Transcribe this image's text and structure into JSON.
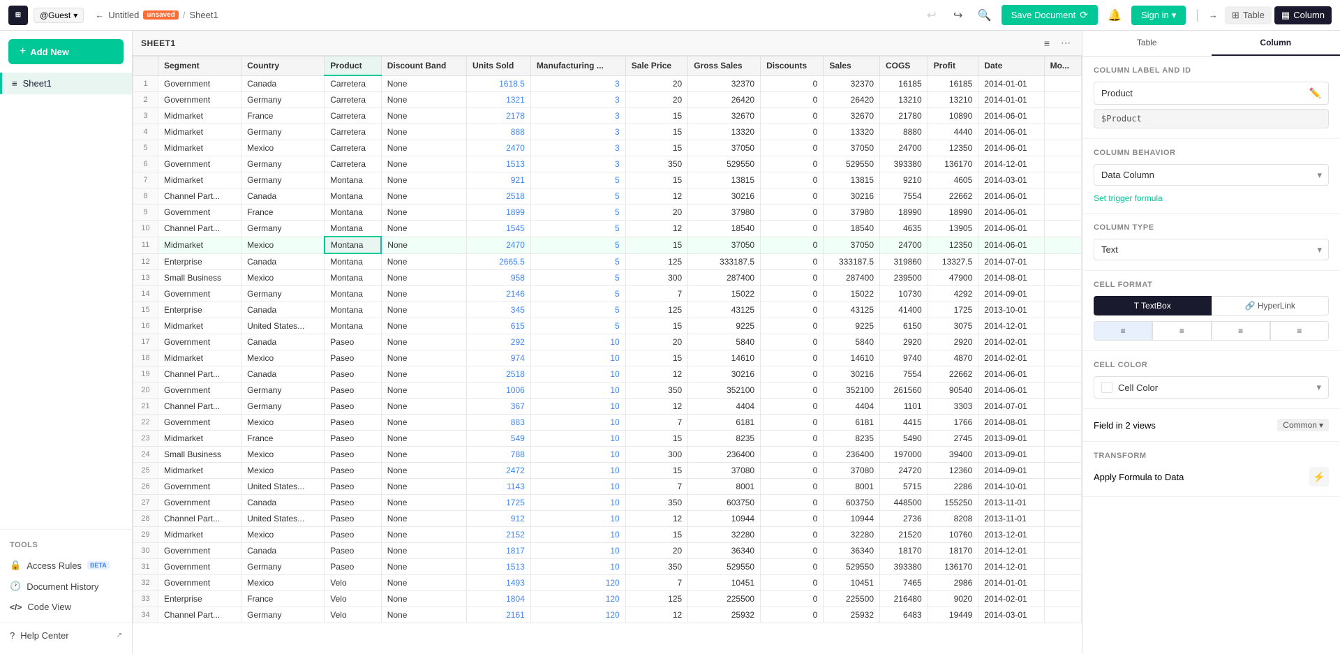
{
  "topbar": {
    "logo_text": "⊞",
    "user": "@Guest",
    "breadcrumb": {
      "doc": "Untitled",
      "unsaved": "unsaved",
      "sheet": "Sheet1"
    },
    "undo_label": "↩",
    "redo_label": "↪",
    "search_icon": "🔍",
    "save_doc_label": "Save Document",
    "bell_icon": "🔔",
    "sign_in_label": "Sign in",
    "arrow_icon": "→",
    "view_table": "Table",
    "view_column": "Column"
  },
  "sidebar": {
    "add_new": "Add New",
    "sheet_name": "Sheet1",
    "tools_label": "TOOLS",
    "tools": [
      {
        "label": "Access Rules",
        "badge": "BETA",
        "icon": "🔒",
        "ext": false
      },
      {
        "label": "Document History",
        "badge": "",
        "icon": "🕐",
        "ext": false
      },
      {
        "label": "Code View",
        "badge": "",
        "icon": "</>",
        "ext": false
      }
    ],
    "help": "Help Center",
    "help_icon": "?"
  },
  "sheet_tab": {
    "label": "SHEET1",
    "filter_icon": "≡",
    "more_icon": "⋯"
  },
  "table": {
    "columns": [
      "",
      "Segment",
      "Country",
      "Product",
      "Discount Band",
      "Units Sold",
      "Manufacturing ...",
      "Sale Price",
      "Gross Sales",
      "Discounts",
      "Sales",
      "COGS",
      "Profit",
      "Date",
      "Mo..."
    ],
    "highlighted_col": 3,
    "rows": [
      [
        1,
        "Government",
        "Canada",
        "Carretera",
        "None",
        "1618.5",
        "3",
        "20",
        "32370",
        "0",
        "32370",
        "16185",
        "16185",
        "2014-01-01",
        ""
      ],
      [
        2,
        "Government",
        "Germany",
        "Carretera",
        "None",
        "1321",
        "3",
        "20",
        "26420",
        "0",
        "26420",
        "13210",
        "13210",
        "2014-01-01",
        ""
      ],
      [
        3,
        "Midmarket",
        "France",
        "Carretera",
        "None",
        "2178",
        "3",
        "15",
        "32670",
        "0",
        "32670",
        "21780",
        "10890",
        "2014-06-01",
        ""
      ],
      [
        4,
        "Midmarket",
        "Germany",
        "Carretera",
        "None",
        "888",
        "3",
        "15",
        "13320",
        "0",
        "13320",
        "8880",
        "4440",
        "2014-06-01",
        ""
      ],
      [
        5,
        "Midmarket",
        "Mexico",
        "Carretera",
        "None",
        "2470",
        "3",
        "15",
        "37050",
        "0",
        "37050",
        "24700",
        "12350",
        "2014-06-01",
        ""
      ],
      [
        6,
        "Government",
        "Germany",
        "Carretera",
        "None",
        "1513",
        "3",
        "350",
        "529550",
        "0",
        "529550",
        "393380",
        "136170",
        "2014-12-01",
        ""
      ],
      [
        7,
        "Midmarket",
        "Germany",
        "Montana",
        "None",
        "921",
        "5",
        "15",
        "13815",
        "0",
        "13815",
        "9210",
        "4605",
        "2014-03-01",
        ""
      ],
      [
        8,
        "Channel Part...",
        "Canada",
        "Montana",
        "None",
        "2518",
        "5",
        "12",
        "30216",
        "0",
        "30216",
        "7554",
        "22662",
        "2014-06-01",
        ""
      ],
      [
        9,
        "Government",
        "France",
        "Montana",
        "None",
        "1899",
        "5",
        "20",
        "37980",
        "0",
        "37980",
        "18990",
        "18990",
        "2014-06-01",
        ""
      ],
      [
        10,
        "Channel Part...",
        "Germany",
        "Montana",
        "None",
        "1545",
        "5",
        "12",
        "18540",
        "0",
        "18540",
        "4635",
        "13905",
        "2014-06-01",
        ""
      ],
      [
        11,
        "Midmarket",
        "Mexico",
        "Montana",
        "None",
        "2470",
        "5",
        "15",
        "37050",
        "0",
        "37050",
        "24700",
        "12350",
        "2014-06-01",
        ""
      ],
      [
        12,
        "Enterprise",
        "Canada",
        "Montana",
        "None",
        "2665.5",
        "5",
        "125",
        "333187.5",
        "0",
        "333187.5",
        "319860",
        "13327.5",
        "2014-07-01",
        ""
      ],
      [
        13,
        "Small Business",
        "Mexico",
        "Montana",
        "None",
        "958",
        "5",
        "300",
        "287400",
        "0",
        "287400",
        "239500",
        "47900",
        "2014-08-01",
        ""
      ],
      [
        14,
        "Government",
        "Germany",
        "Montana",
        "None",
        "2146",
        "5",
        "7",
        "15022",
        "0",
        "15022",
        "10730",
        "4292",
        "2014-09-01",
        ""
      ],
      [
        15,
        "Enterprise",
        "Canada",
        "Montana",
        "None",
        "345",
        "5",
        "125",
        "43125",
        "0",
        "43125",
        "41400",
        "1725",
        "2013-10-01",
        ""
      ],
      [
        16,
        "Midmarket",
        "United States...",
        "Montana",
        "None",
        "615",
        "5",
        "15",
        "9225",
        "0",
        "9225",
        "6150",
        "3075",
        "2014-12-01",
        ""
      ],
      [
        17,
        "Government",
        "Canada",
        "Paseo",
        "None",
        "292",
        "10",
        "20",
        "5840",
        "0",
        "5840",
        "2920",
        "2920",
        "2014-02-01",
        ""
      ],
      [
        18,
        "Midmarket",
        "Mexico",
        "Paseo",
        "None",
        "974",
        "10",
        "15",
        "14610",
        "0",
        "14610",
        "9740",
        "4870",
        "2014-02-01",
        ""
      ],
      [
        19,
        "Channel Part...",
        "Canada",
        "Paseo",
        "None",
        "2518",
        "10",
        "12",
        "30216",
        "0",
        "30216",
        "7554",
        "22662",
        "2014-06-01",
        ""
      ],
      [
        20,
        "Government",
        "Germany",
        "Paseo",
        "None",
        "1006",
        "10",
        "350",
        "352100",
        "0",
        "352100",
        "261560",
        "90540",
        "2014-06-01",
        ""
      ],
      [
        21,
        "Channel Part...",
        "Germany",
        "Paseo",
        "None",
        "367",
        "10",
        "12",
        "4404",
        "0",
        "4404",
        "1101",
        "3303",
        "2014-07-01",
        ""
      ],
      [
        22,
        "Government",
        "Mexico",
        "Paseo",
        "None",
        "883",
        "10",
        "7",
        "6181",
        "0",
        "6181",
        "4415",
        "1766",
        "2014-08-01",
        ""
      ],
      [
        23,
        "Midmarket",
        "France",
        "Paseo",
        "None",
        "549",
        "10",
        "15",
        "8235",
        "0",
        "8235",
        "5490",
        "2745",
        "2013-09-01",
        ""
      ],
      [
        24,
        "Small Business",
        "Mexico",
        "Paseo",
        "None",
        "788",
        "10",
        "300",
        "236400",
        "0",
        "236400",
        "197000",
        "39400",
        "2013-09-01",
        ""
      ],
      [
        25,
        "Midmarket",
        "Mexico",
        "Paseo",
        "None",
        "2472",
        "10",
        "15",
        "37080",
        "0",
        "37080",
        "24720",
        "12360",
        "2014-09-01",
        ""
      ],
      [
        26,
        "Government",
        "United States...",
        "Paseo",
        "None",
        "1143",
        "10",
        "7",
        "8001",
        "0",
        "8001",
        "5715",
        "2286",
        "2014-10-01",
        ""
      ],
      [
        27,
        "Government",
        "Canada",
        "Paseo",
        "None",
        "1725",
        "10",
        "350",
        "603750",
        "0",
        "603750",
        "448500",
        "155250",
        "2013-11-01",
        ""
      ],
      [
        28,
        "Channel Part...",
        "United States...",
        "Paseo",
        "None",
        "912",
        "10",
        "12",
        "10944",
        "0",
        "10944",
        "2736",
        "8208",
        "2013-11-01",
        ""
      ],
      [
        29,
        "Midmarket",
        "Mexico",
        "Paseo",
        "None",
        "2152",
        "10",
        "15",
        "32280",
        "0",
        "32280",
        "21520",
        "10760",
        "2013-12-01",
        ""
      ],
      [
        30,
        "Government",
        "Canada",
        "Paseo",
        "None",
        "1817",
        "10",
        "20",
        "36340",
        "0",
        "36340",
        "18170",
        "18170",
        "2014-12-01",
        ""
      ],
      [
        31,
        "Government",
        "Germany",
        "Paseo",
        "None",
        "1513",
        "10",
        "350",
        "529550",
        "0",
        "529550",
        "393380",
        "136170",
        "2014-12-01",
        ""
      ],
      [
        32,
        "Government",
        "Mexico",
        "Velo",
        "None",
        "1493",
        "120",
        "7",
        "10451",
        "0",
        "10451",
        "7465",
        "2986",
        "2014-01-01",
        ""
      ],
      [
        33,
        "Enterprise",
        "France",
        "Velo",
        "None",
        "1804",
        "120",
        "125",
        "225500",
        "0",
        "225500",
        "216480",
        "9020",
        "2014-02-01",
        ""
      ],
      [
        34,
        "Channel Part...",
        "Germany",
        "Velo",
        "None",
        "2161",
        "120",
        "12",
        "25932",
        "0",
        "25932",
        "6483",
        "19449",
        "2014-03-01",
        ""
      ]
    ],
    "blue_col_indices": [
      5,
      6
    ],
    "orange_col_indices": []
  },
  "right_panel": {
    "tabs": [
      "Table",
      "Column"
    ],
    "active_tab": "Column",
    "section_label_id": "COLUMN LABEL AND ID",
    "field_label_value": "Product",
    "field_id_value": "$Product",
    "section_behavior": "COLUMN BEHAVIOR",
    "behavior_value": "Data Column",
    "trigger_formula_link": "Set trigger formula",
    "section_type": "COLUMN TYPE",
    "type_value": "Text",
    "section_format": "CELL FORMAT",
    "format_textbox": "TextBox",
    "format_hyperlink": "HyperLink",
    "align_left": "≡",
    "align_center": "≡",
    "align_right": "≡",
    "align_justify": "≡",
    "section_color": "CELL COLOR",
    "color_label": "Cell Color",
    "field_views_label": "Field in 2 views",
    "common_label": "Common",
    "section_transform": "TRANSFORM",
    "apply_formula": "Apply Formula to Data"
  }
}
